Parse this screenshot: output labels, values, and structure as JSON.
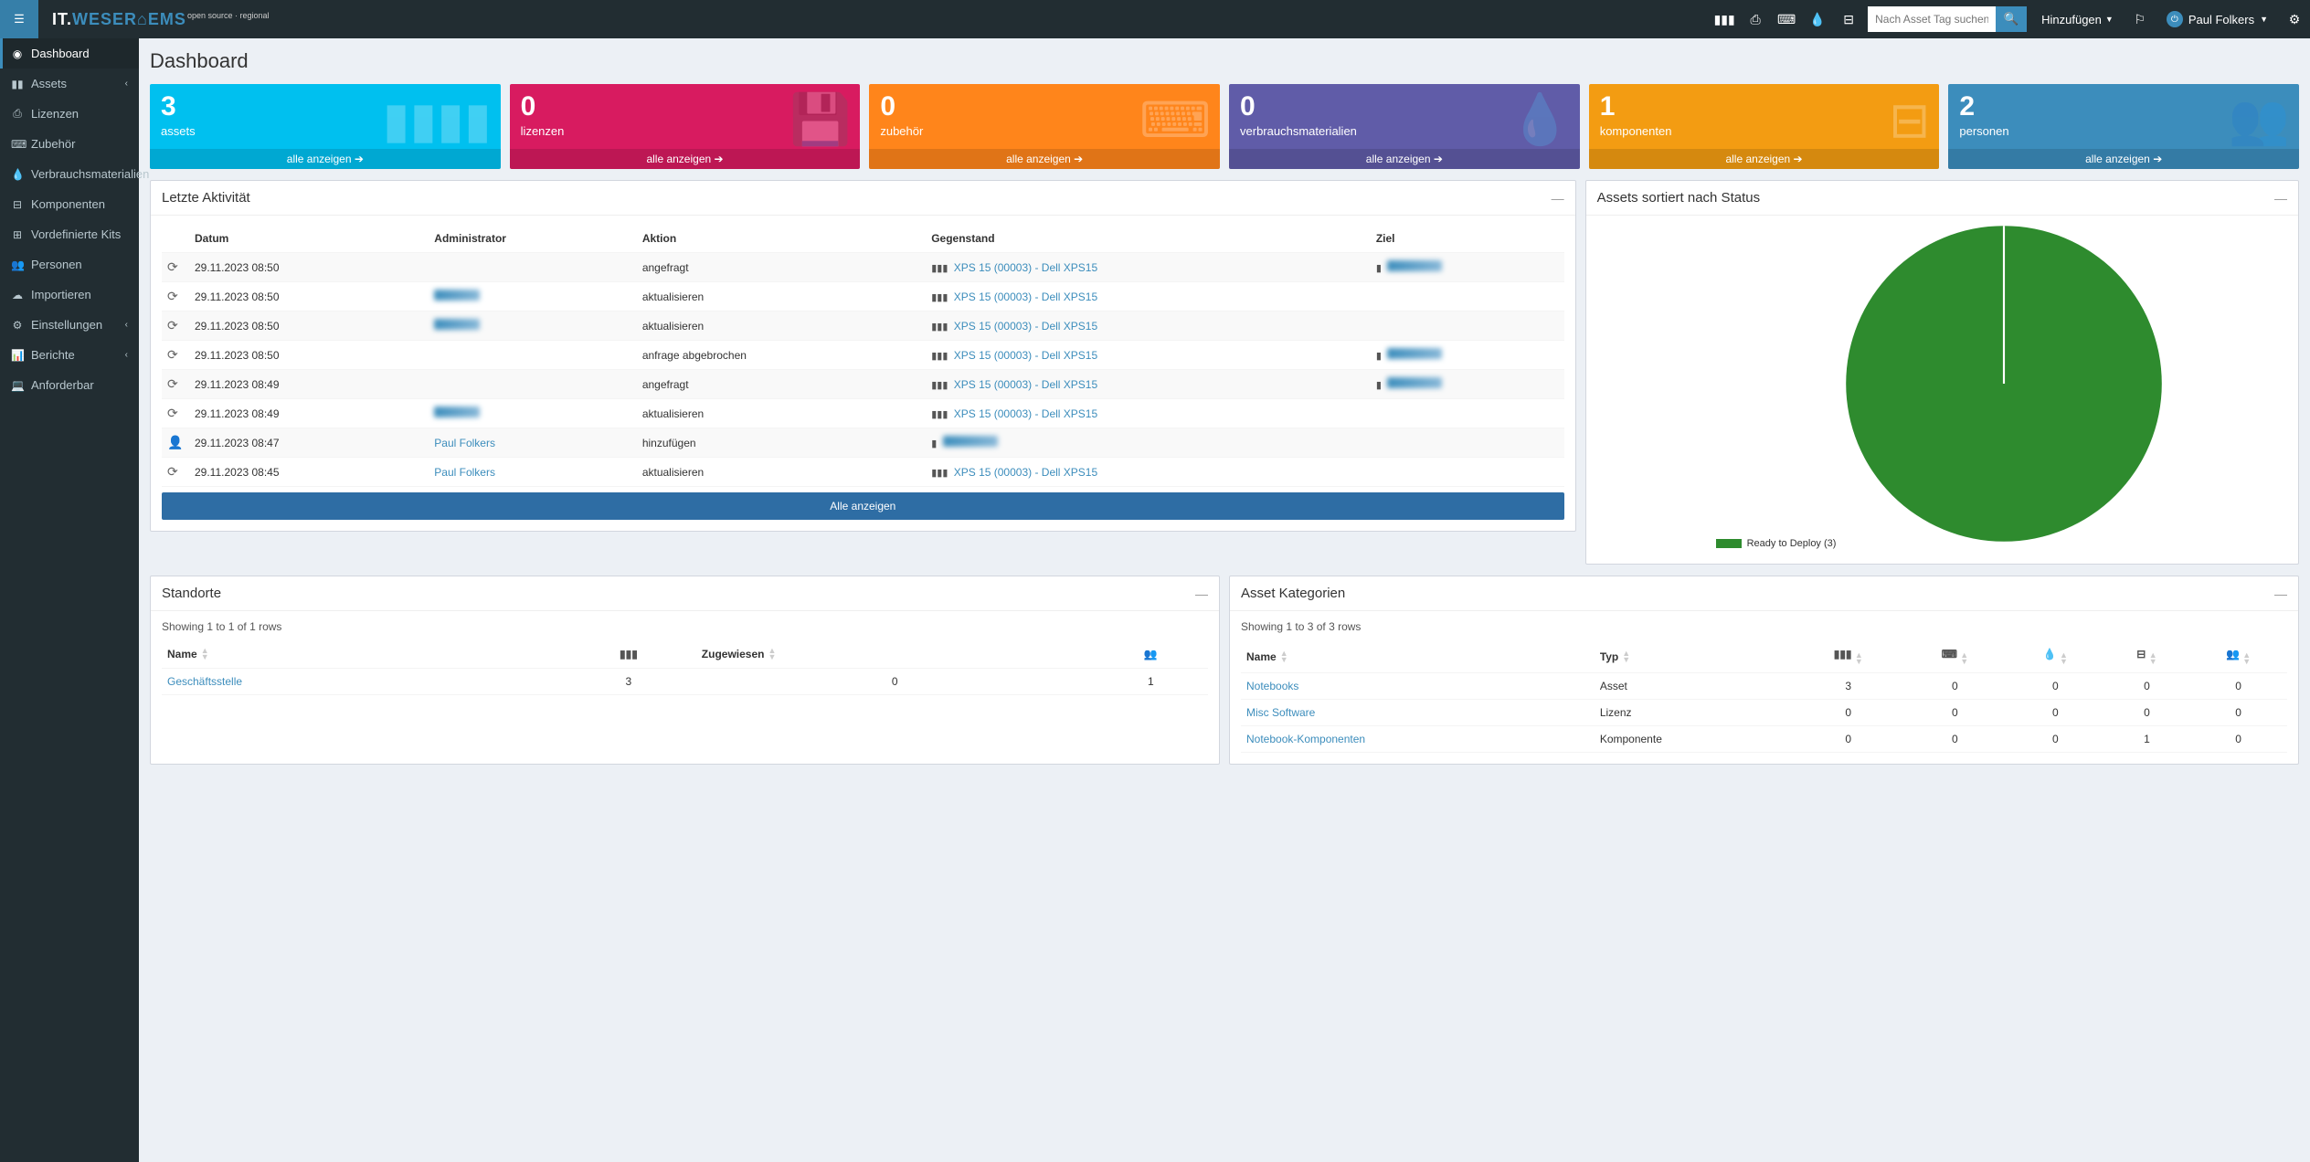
{
  "brand": {
    "it": "IT.",
    "rest": "WESER⌂EMS",
    "tagline": "open source · regional"
  },
  "search": {
    "placeholder": "Nach Asset Tag suchen"
  },
  "topbar": {
    "add": "Hinzufügen",
    "user": "Paul Folkers"
  },
  "sidebar": {
    "items": [
      {
        "label": "Dashboard"
      },
      {
        "label": "Assets"
      },
      {
        "label": "Lizenzen"
      },
      {
        "label": "Zubehör"
      },
      {
        "label": "Verbrauchsmaterialien"
      },
      {
        "label": "Komponenten"
      },
      {
        "label": "Vordefinierte Kits"
      },
      {
        "label": "Personen"
      },
      {
        "label": "Importieren"
      },
      {
        "label": "Einstellungen"
      },
      {
        "label": "Berichte"
      },
      {
        "label": "Anforderbar"
      }
    ]
  },
  "pageTitle": "Dashboard",
  "stats": {
    "viewAll": "alle anzeigen",
    "items": [
      {
        "num": "3",
        "label": "assets"
      },
      {
        "num": "0",
        "label": "lizenzen"
      },
      {
        "num": "0",
        "label": "zubehör"
      },
      {
        "num": "0",
        "label": "verbrauchsmaterialien"
      },
      {
        "num": "1",
        "label": "komponenten"
      },
      {
        "num": "2",
        "label": "personen"
      }
    ]
  },
  "activity": {
    "title": "Letzte Aktivität",
    "cols": {
      "date": "Datum",
      "admin": "Administrator",
      "action": "Aktion",
      "item": "Gegenstand",
      "target": "Ziel"
    },
    "rows": [
      {
        "icon": "refresh",
        "date": "29.11.2023 08:50",
        "admin": "",
        "action": "angefragt",
        "item": "XPS 15 (00003) - Dell XPS15",
        "target": "blur"
      },
      {
        "icon": "refresh",
        "date": "29.11.2023 08:50",
        "admin": "blur",
        "action": "aktualisieren",
        "item": "XPS 15 (00003) - Dell XPS15",
        "target": ""
      },
      {
        "icon": "refresh",
        "date": "29.11.2023 08:50",
        "admin": "blur",
        "action": "aktualisieren",
        "item": "XPS 15 (00003) - Dell XPS15",
        "target": ""
      },
      {
        "icon": "refresh",
        "date": "29.11.2023 08:50",
        "admin": "",
        "action": "anfrage abgebrochen",
        "item": "XPS 15 (00003) - Dell XPS15",
        "target": "blur"
      },
      {
        "icon": "refresh",
        "date": "29.11.2023 08:49",
        "admin": "",
        "action": "angefragt",
        "item": "XPS 15 (00003) - Dell XPS15",
        "target": "blur"
      },
      {
        "icon": "refresh",
        "date": "29.11.2023 08:49",
        "admin": "blur",
        "action": "aktualisieren",
        "item": "XPS 15 (00003) - Dell XPS15",
        "target": ""
      },
      {
        "icon": "user",
        "date": "29.11.2023 08:47",
        "admin": "Paul Folkers",
        "action": "hinzufügen",
        "item": "blur-short",
        "target": ""
      },
      {
        "icon": "refresh",
        "date": "29.11.2023 08:45",
        "admin": "Paul Folkers",
        "action": "aktualisieren",
        "item": "XPS 15 (00003) - Dell XPS15",
        "target": ""
      }
    ],
    "viewAll": "Alle anzeigen"
  },
  "statusPie": {
    "title": "Assets sortiert nach Status",
    "legend": "Ready to Deploy (3)"
  },
  "chart_data": {
    "type": "pie",
    "title": "Assets sortiert nach Status",
    "series": [
      {
        "name": "Ready to Deploy",
        "value": 3,
        "color": "#2e8b2e"
      }
    ]
  },
  "locations": {
    "title": "Standorte",
    "showing": "Showing 1 to 1 of 1 rows",
    "cols": {
      "name": "Name",
      "assigned": "Zugewiesen"
    },
    "rows": [
      {
        "name": "Geschäftsstelle",
        "barcode": "3",
        "assigned": "0",
        "people": "1"
      }
    ]
  },
  "categories": {
    "title": "Asset Kategorien",
    "showing": "Showing 1 to 3 of 3 rows",
    "cols": {
      "name": "Name",
      "type": "Typ"
    },
    "rows": [
      {
        "name": "Notebooks",
        "type": "Asset",
        "barcode": "3",
        "license": "0",
        "keyboard": "0",
        "drop": "0",
        "hdd": "0",
        "users": "0"
      },
      {
        "name": "Misc Software",
        "type": "Lizenz",
        "barcode": "0",
        "license": "0",
        "keyboard": "0",
        "drop": "0",
        "hdd": "0",
        "users": "0"
      },
      {
        "name": "Notebook-Komponenten",
        "type": "Komponente",
        "barcode": "0",
        "license": "0",
        "keyboard": "0",
        "drop": "1",
        "hdd": "0",
        "users": "0"
      }
    ]
  }
}
